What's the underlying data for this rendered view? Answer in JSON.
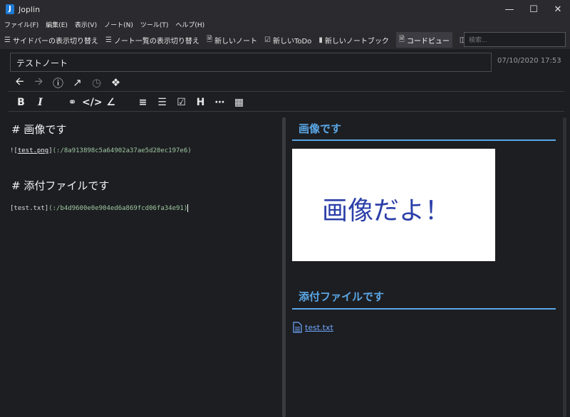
{
  "window": {
    "title": "Joplin",
    "app_icon_letter": "J"
  },
  "menu": [
    "ファイル(F)",
    "編集(E)",
    "表示(V)",
    "ノート(N)",
    "ツール(T)",
    "ヘルプ(H)"
  ],
  "toolbar": {
    "toggle_sidebar": "サイドバーの表示切り替え",
    "toggle_notelist": "ノート一覧の表示切り替え",
    "new_note": "新しいノート",
    "new_todo": "新しいToDo",
    "new_notebook": "新しいノートブック",
    "code_view": "コードビュー"
  },
  "search": {
    "placeholder": "検索..."
  },
  "note": {
    "title": "テストノート",
    "date": "07/10/2020 17:53"
  },
  "editor": {
    "heading1": "#  画像です",
    "image_prefix": "![",
    "image_alt": "test.png",
    "image_mid": "]",
    "image_url": "(:/8a913898c5a64902a37ae5d20ec197e6)",
    "heading2": "#  添付ファイルです",
    "attach_text": "[test.txt]",
    "attach_url": "(:/b4d9600e0e904ed6a869fcd06fa34e91)"
  },
  "viewer": {
    "heading1": "画像です",
    "image_text": "画像だよ！",
    "heading2": "添付ファイルです",
    "attachment_link": "test.txt"
  },
  "colors": {
    "background": "#1d1e22",
    "accent": "#5aa7e6",
    "link": "#6fa7ff",
    "image_text": "#2b3fa8"
  }
}
